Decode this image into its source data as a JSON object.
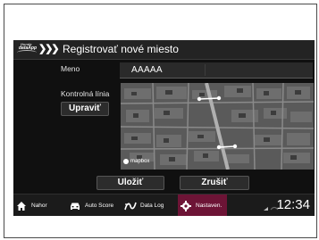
{
  "window": {
    "title": "Registrovať nové miesto"
  },
  "logo": {
    "brand_small": "Honda",
    "brand_big": "dataApp"
  },
  "form": {
    "name_label": "Meno",
    "name_value": "AAAAA",
    "checkline_label": "Kontrolná línia",
    "edit_button": "Upraviť"
  },
  "map": {
    "attribution": "mapbox"
  },
  "actions": {
    "save": "Uložiť",
    "cancel": "Zrušiť"
  },
  "nav": {
    "items": [
      {
        "label": "Nahor",
        "icon": "home-icon"
      },
      {
        "label": "Auto Score",
        "icon": "car-icon"
      },
      {
        "label": "Data Log",
        "icon": "track-icon"
      },
      {
        "label": "Nastaven.",
        "icon": "gear-icon",
        "active": true
      }
    ],
    "active_color": "#6d1436"
  },
  "status": {
    "time": "12:34"
  },
  "colors": {
    "background": "#101010",
    "text": "#ffffff"
  }
}
